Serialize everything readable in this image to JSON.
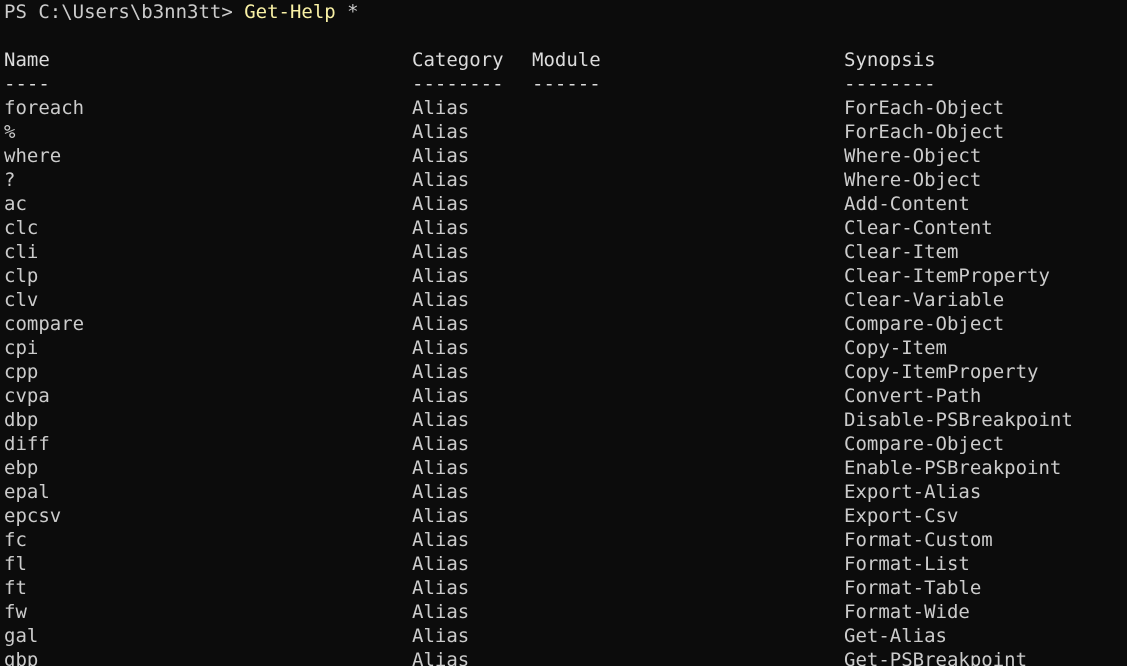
{
  "prompt": {
    "text": "PS C:\\Users\\b3nn3tt> ",
    "command": "Get-Help",
    "argument": " *"
  },
  "table": {
    "headers": {
      "name": "Name",
      "category": "Category",
      "module": "Module",
      "synopsis": "Synopsis"
    },
    "underlines": {
      "name": "----",
      "category": "--------",
      "module": "------",
      "synopsis": "--------"
    },
    "rows": [
      {
        "name": "foreach",
        "category": "Alias",
        "module": "",
        "synopsis": "ForEach-Object"
      },
      {
        "name": "%",
        "category": "Alias",
        "module": "",
        "synopsis": "ForEach-Object"
      },
      {
        "name": "where",
        "category": "Alias",
        "module": "",
        "synopsis": "Where-Object"
      },
      {
        "name": "?",
        "category": "Alias",
        "module": "",
        "synopsis": "Where-Object"
      },
      {
        "name": "ac",
        "category": "Alias",
        "module": "",
        "synopsis": "Add-Content"
      },
      {
        "name": "clc",
        "category": "Alias",
        "module": "",
        "synopsis": "Clear-Content"
      },
      {
        "name": "cli",
        "category": "Alias",
        "module": "",
        "synopsis": "Clear-Item"
      },
      {
        "name": "clp",
        "category": "Alias",
        "module": "",
        "synopsis": "Clear-ItemProperty"
      },
      {
        "name": "clv",
        "category": "Alias",
        "module": "",
        "synopsis": "Clear-Variable"
      },
      {
        "name": "compare",
        "category": "Alias",
        "module": "",
        "synopsis": "Compare-Object"
      },
      {
        "name": "cpi",
        "category": "Alias",
        "module": "",
        "synopsis": "Copy-Item"
      },
      {
        "name": "cpp",
        "category": "Alias",
        "module": "",
        "synopsis": "Copy-ItemProperty"
      },
      {
        "name": "cvpa",
        "category": "Alias",
        "module": "",
        "synopsis": "Convert-Path"
      },
      {
        "name": "dbp",
        "category": "Alias",
        "module": "",
        "synopsis": "Disable-PSBreakpoint"
      },
      {
        "name": "diff",
        "category": "Alias",
        "module": "",
        "synopsis": "Compare-Object"
      },
      {
        "name": "ebp",
        "category": "Alias",
        "module": "",
        "synopsis": "Enable-PSBreakpoint"
      },
      {
        "name": "epal",
        "category": "Alias",
        "module": "",
        "synopsis": "Export-Alias"
      },
      {
        "name": "epcsv",
        "category": "Alias",
        "module": "",
        "synopsis": "Export-Csv"
      },
      {
        "name": "fc",
        "category": "Alias",
        "module": "",
        "synopsis": "Format-Custom"
      },
      {
        "name": "fl",
        "category": "Alias",
        "module": "",
        "synopsis": "Format-List"
      },
      {
        "name": "ft",
        "category": "Alias",
        "module": "",
        "synopsis": "Format-Table"
      },
      {
        "name": "fw",
        "category": "Alias",
        "module": "",
        "synopsis": "Format-Wide"
      },
      {
        "name": "gal",
        "category": "Alias",
        "module": "",
        "synopsis": "Get-Alias"
      },
      {
        "name": "gbp",
        "category": "Alias",
        "module": "",
        "synopsis": "Get-PSBreakpoint"
      }
    ]
  },
  "colors": {
    "background": "#0c0c0c",
    "foreground": "#cccccc",
    "command": "#f9f1a5"
  }
}
